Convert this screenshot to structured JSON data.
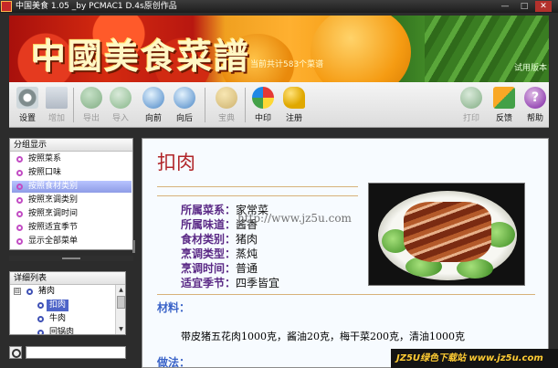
{
  "window": {
    "title": "中国美食 1.05 _by PCMAC1  D.4s原创作品",
    "minimize": "—",
    "maximize": "□",
    "close": "✕"
  },
  "banner": {
    "brand": "中國美食菜譜",
    "count_text": "当前共计583个菜谱",
    "version": "试用版本"
  },
  "toolbar": {
    "settings": "设置",
    "add": "增加",
    "export": "导出",
    "import": "导入",
    "prev": "向前",
    "next": "向后",
    "treasure": "宝典",
    "print_cn": "中印",
    "register": "注册",
    "print": "打印",
    "feedback": "反馈",
    "help": "帮助",
    "help_glyph": "?"
  },
  "group_panel": {
    "header": "分组显示",
    "items": [
      "按照菜系",
      "按照口味",
      "按照食材类别",
      "按照烹调类别",
      "按照烹调时间",
      "按照适宜季节",
      "显示全部菜单"
    ],
    "selected_index": 2
  },
  "detail_panel": {
    "header": "详细列表",
    "tree": [
      {
        "label": "猪肉",
        "expand": "⊟"
      },
      {
        "label": "扣肉"
      },
      {
        "label": "牛肉"
      },
      {
        "label": "回锅肉"
      }
    ],
    "scroll_up": "▲",
    "scroll_down": "▼"
  },
  "search": {
    "value": "",
    "placeholder": ""
  },
  "recipe": {
    "title": "扣肉",
    "watermark": "http://www.jz5u.com",
    "fields": [
      {
        "key": "所属菜系：",
        "value": "家常菜"
      },
      {
        "key": "所属味道：",
        "value": "酱香"
      },
      {
        "key": "食材类别：",
        "value": "猪肉"
      },
      {
        "key": "烹调类型：",
        "value": "蒸炖"
      },
      {
        "key": "烹调时间：",
        "value": "普通"
      },
      {
        "key": "适宜季节：",
        "value": "四季皆宜"
      }
    ],
    "materials_label": "材料：",
    "materials_text": "带皮猪五花肉1000克，酱油20克，梅干菜200克，清油1000克",
    "steps_label": "做法："
  },
  "bottom_banner": "JZ5U绿色下载站 www.jz5u.com",
  "colors": {
    "title_red": "#b1262a",
    "label_purple": "#5b2a86",
    "section_blue": "#3a63c8",
    "selection": "#8e9ce6"
  }
}
